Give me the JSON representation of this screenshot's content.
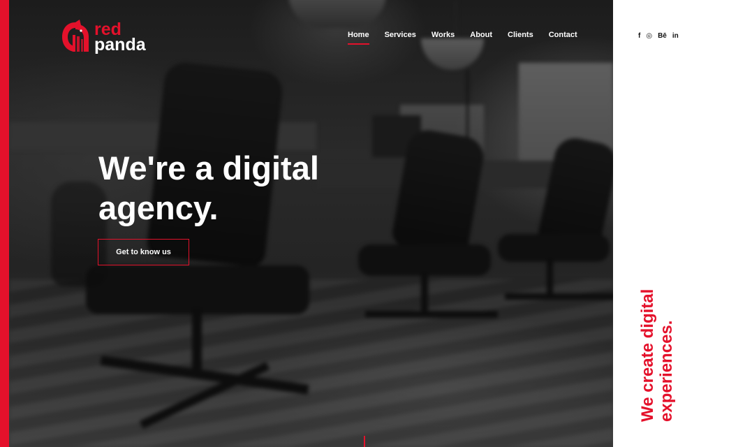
{
  "brand": {
    "name_line1": "red",
    "name_line2": "panda",
    "logo_icon": "red-panda-logo-icon",
    "accent_color": "#e4112b"
  },
  "nav": {
    "items": [
      {
        "label": "Home",
        "active": true
      },
      {
        "label": "Services",
        "active": false
      },
      {
        "label": "Works",
        "active": false
      },
      {
        "label": "About",
        "active": false
      },
      {
        "label": "Clients",
        "active": false
      },
      {
        "label": "Contact",
        "active": false
      }
    ]
  },
  "hero": {
    "headline_line1": "We're a digital",
    "headline_line2": "agency.",
    "cta_label": "Get to know us"
  },
  "social": {
    "items": [
      {
        "label": "f",
        "icon": "facebook-icon"
      },
      {
        "label": "◎",
        "icon": "instagram-icon"
      },
      {
        "label": "Bē",
        "icon": "behance-icon"
      },
      {
        "label": "in",
        "icon": "linkedin-icon"
      }
    ]
  },
  "side": {
    "tagline_line1": "We create digital",
    "tagline_line2": "experiences."
  }
}
